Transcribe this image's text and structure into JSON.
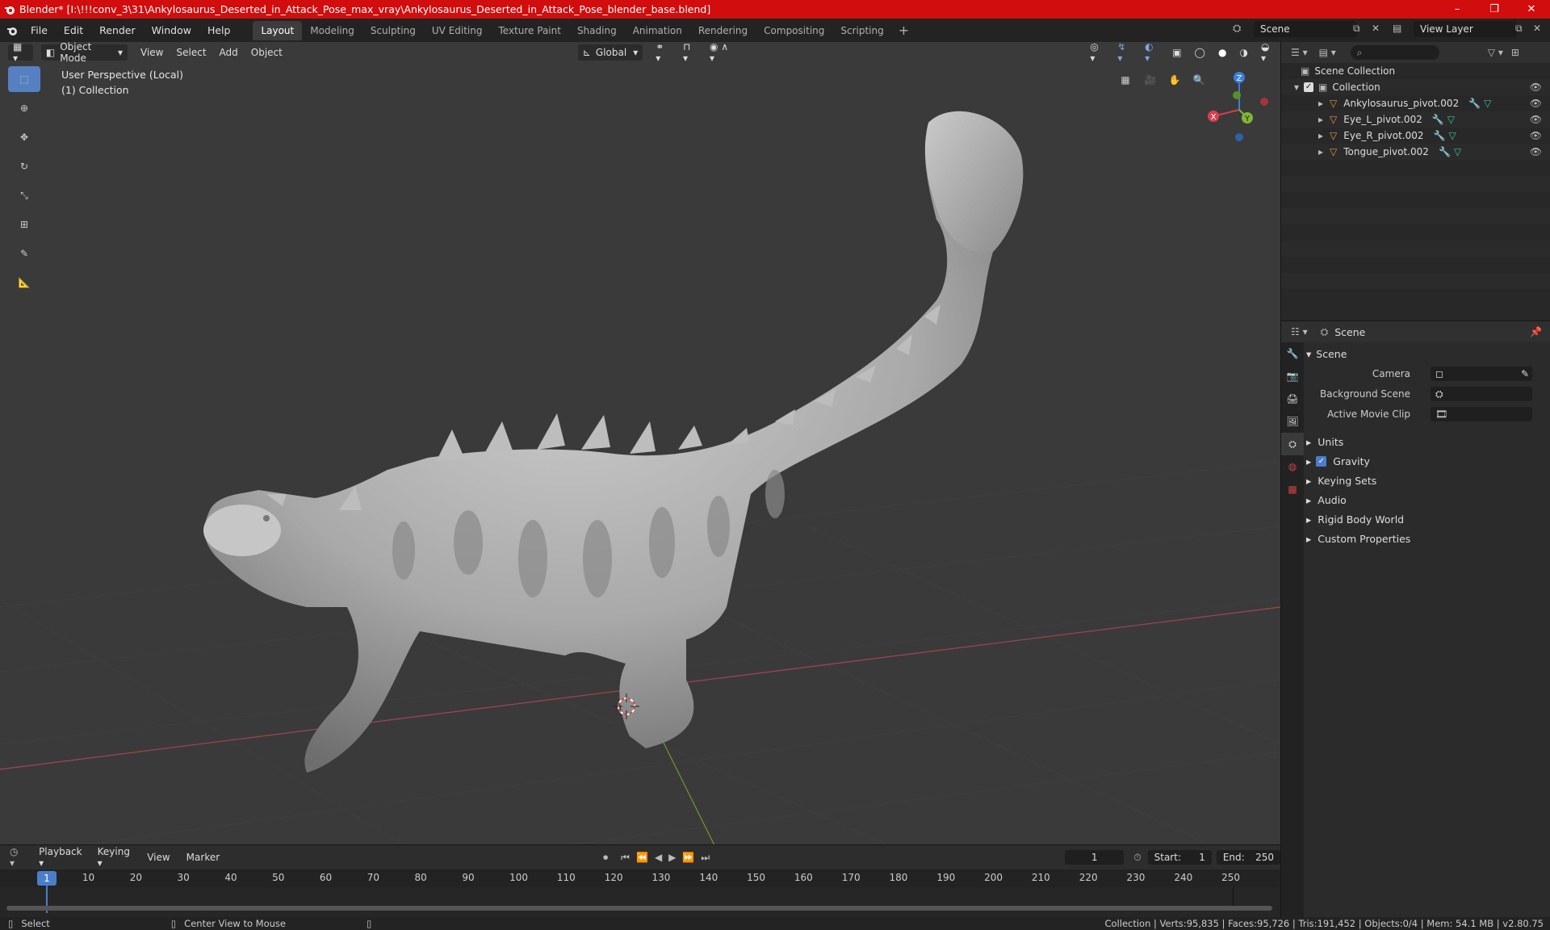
{
  "window": {
    "title": "Blender* [I:\\!!!conv_3\\31\\Ankylosaurus_Deserted_in_Attack_Pose_max_vray\\Ankylosaurus_Deserted_in_Attack_Pose_blender_base.blend]",
    "controls": [
      "–",
      "❐",
      "✕"
    ]
  },
  "menu": [
    "File",
    "Edit",
    "Render",
    "Window",
    "Help"
  ],
  "workspaces": [
    {
      "label": "Layout",
      "active": true
    },
    {
      "label": "Modeling"
    },
    {
      "label": "Sculpting"
    },
    {
      "label": "UV Editing"
    },
    {
      "label": "Texture Paint"
    },
    {
      "label": "Shading"
    },
    {
      "label": "Animation"
    },
    {
      "label": "Rendering"
    },
    {
      "label": "Compositing"
    },
    {
      "label": "Scripting"
    }
  ],
  "scene_selector": {
    "value": "Scene"
  },
  "viewlayer_selector": {
    "value": "View Layer"
  },
  "viewport_header": {
    "mode": "Object Mode",
    "menus": [
      "View",
      "Select",
      "Add",
      "Object"
    ],
    "orientation": "Global"
  },
  "viewport": {
    "perspective": "User Perspective (Local)",
    "collection": "(1) Collection",
    "gizmo": {
      "x": "X",
      "y": "Y",
      "z": "Z"
    }
  },
  "outliner": {
    "root": "Scene Collection",
    "collection": "Collection",
    "items": [
      {
        "name": "Ankylosaurus_pivot.002"
      },
      {
        "name": "Eye_L_pivot.002"
      },
      {
        "name": "Eye_R_pivot.002"
      },
      {
        "name": "Tongue_pivot.002"
      }
    ]
  },
  "properties": {
    "header": "Scene",
    "panel": "Scene",
    "fields": {
      "camera": "Camera",
      "background": "Background Scene",
      "movie_clip": "Active Movie Clip"
    },
    "sections": [
      "Units",
      "Gravity",
      "Keying Sets",
      "Audio",
      "Rigid Body World",
      "Custom Properties"
    ],
    "gravity_checked": true
  },
  "timeline": {
    "menus": [
      "Playback",
      "Keying",
      "View",
      "Marker"
    ],
    "current_frame": "1",
    "start_label": "Start:",
    "start": "1",
    "end_label": "End:",
    "end": "250",
    "ticks": [
      "1",
      "10",
      "20",
      "30",
      "40",
      "50",
      "60",
      "70",
      "80",
      "90",
      "100",
      "110",
      "120",
      "130",
      "140",
      "150",
      "160",
      "170",
      "180",
      "190",
      "200",
      "210",
      "220",
      "230",
      "240",
      "250"
    ]
  },
  "status": {
    "select": "Select",
    "center": "Center View to Mouse",
    "stats": "Collection | Verts:95,835 | Faces:95,726 | Tris:191,452 | Objects:0/4 | Mem: 54.1 MB | v2.80.75"
  },
  "colors": {
    "accent": "#5680c2",
    "titlebar": "#d10d0d",
    "x_axis": "#d8404f",
    "y_axis": "#7fb832",
    "z_axis": "#3a7fe0"
  }
}
